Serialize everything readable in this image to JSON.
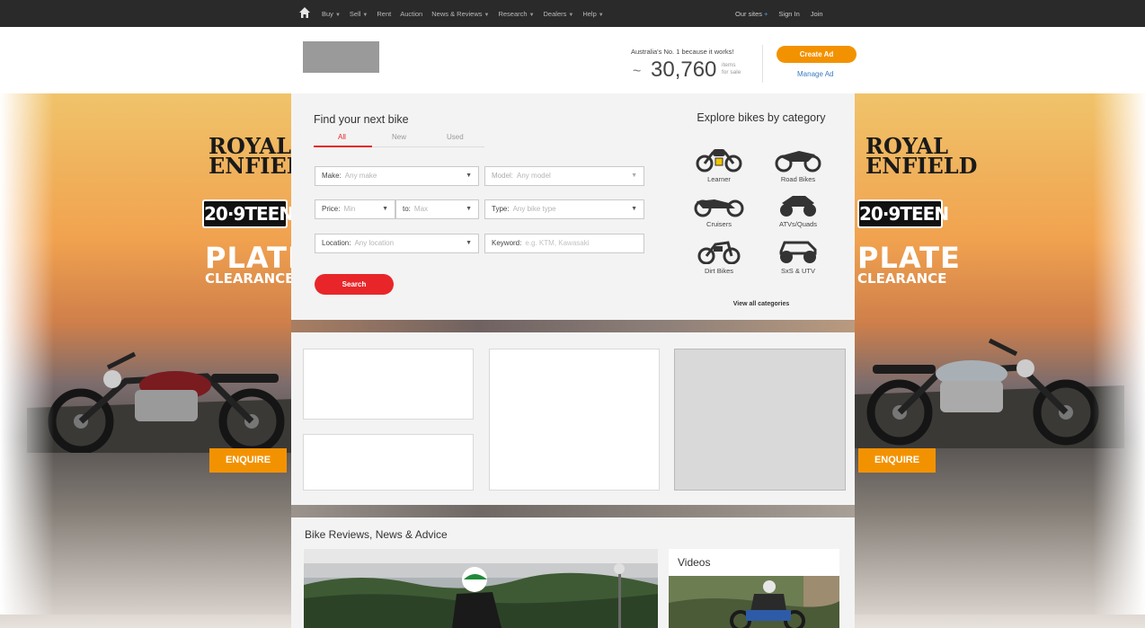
{
  "nav": {
    "items": [
      "Buy",
      "Sell",
      "Rent",
      "Auction",
      "News & Reviews",
      "Research",
      "Dealers",
      "Help"
    ],
    "right": {
      "our_sites": "Our sites",
      "plus": "+",
      "sign_in": "Sign In",
      "join": "Join"
    }
  },
  "header": {
    "tagline": "Australia's No. 1 because it works!",
    "tilde": "~",
    "count": "30,760",
    "count_sub_1": "items",
    "count_sub_2": "for sale",
    "create_ad": "Create Ad",
    "manage_ad": "Manage Ad"
  },
  "banner": {
    "brand_line1": "ROYAL",
    "brand_line2": "ENFIELD",
    "plate": "20·9TEEN",
    "plate_title": "PLATE",
    "plate_sub": "CLEARANCE",
    "enquire": "ENQUIRE"
  },
  "search": {
    "title": "Find your next bike",
    "tabs": [
      "All",
      "New",
      "Used"
    ],
    "active_tab": "All",
    "make_label": "Make:",
    "make_value": "Any make",
    "model_label": "Model:",
    "model_value": "Any model",
    "price_label": "Price:",
    "price_min": "Min",
    "to_label": "to:",
    "price_max": "Max",
    "type_label": "Type:",
    "type_value": "Any bike type",
    "location_label": "Location:",
    "location_value": "Any location",
    "keyword_label": "Keyword:",
    "keyword_placeholder": "e.g. KTM, Kawasaki",
    "search_button": "Search"
  },
  "categories": {
    "title": "Explore bikes by category",
    "items": [
      {
        "label": "Learner",
        "icon": "learner-bike-icon"
      },
      {
        "label": "Road Bikes",
        "icon": "road-bike-icon"
      },
      {
        "label": "Cruisers",
        "icon": "cruiser-icon"
      },
      {
        "label": "ATVs/Quads",
        "icon": "atv-icon"
      },
      {
        "label": "Dirt Bikes",
        "icon": "dirt-bike-icon"
      },
      {
        "label": "SxS & UTV",
        "icon": "sxs-utv-icon"
      }
    ],
    "view_all": "View all categories"
  },
  "news": {
    "title": "Bike Reviews, News & Advice",
    "videos_title": "Videos"
  },
  "colors": {
    "accent_red": "#e8262a",
    "accent_orange": "#f39200",
    "nav_bg": "#2a2a2a",
    "link_blue": "#3b7bbf"
  }
}
